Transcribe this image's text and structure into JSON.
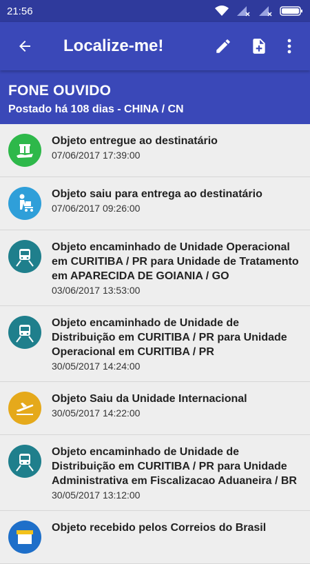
{
  "status": {
    "time": "21:56"
  },
  "appbar": {
    "title": "Localize-me!"
  },
  "package": {
    "name": "FONE OUVIDO",
    "subtitle": "Postado há 108 dias - CHINA / CN"
  },
  "events": [
    {
      "icon": "gift-delivered-icon",
      "color": "#2eb84a",
      "description": "Objeto entregue ao destinatário",
      "date": "07/06/2017 17:39:00"
    },
    {
      "icon": "delivery-person-icon",
      "color": "#2f9fd9",
      "description": "Objeto saiu para entrega ao destinatário",
      "date": "07/06/2017 09:26:00"
    },
    {
      "icon": "truck-icon",
      "color": "#1f7f8c",
      "description": "Objeto encaminhado de Unidade Operacional em CURITIBA / PR para Unidade de Tratamento em APARECIDA DE GOIANIA / GO",
      "date": "03/06/2017 13:53:00"
    },
    {
      "icon": "truck-icon",
      "color": "#1f7f8c",
      "description": "Objeto encaminhado de Unidade de Distribuição em CURITIBA / PR para Unidade Operacional em CURITIBA / PR",
      "date": "30/05/2017 14:24:00"
    },
    {
      "icon": "airplane-icon",
      "color": "#e5a91b",
      "description": "Objeto Saiu da Unidade Internacional",
      "date": "30/05/2017 14:22:00"
    },
    {
      "icon": "truck-icon",
      "color": "#1f7f8c",
      "description": "Objeto encaminhado de Unidade de Distribuição em CURITIBA / PR para Unidade Administrativa em Fiscalizacao Aduaneira / BR",
      "date": "30/05/2017 13:12:00"
    },
    {
      "icon": "post-office-icon",
      "color": "#1e6fc9",
      "description": "Objeto recebido pelos Correios do Brasil",
      "date": ""
    }
  ]
}
